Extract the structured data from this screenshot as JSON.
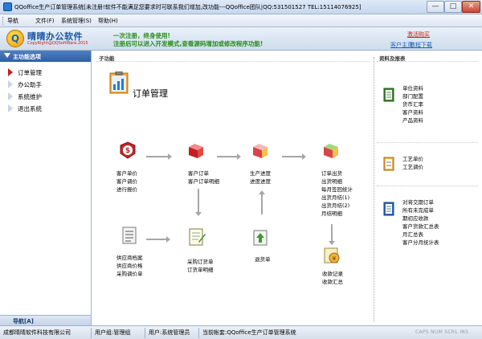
{
  "window": {
    "title": "QQoffice生产订单管理系统[未注册!软件不能满足您要求时可联系我们增加,改功能---QQoffice团队|QQ:531501527 TEL:15114076925]",
    "min_label": "—",
    "max_label": "□",
    "close_label": "✕"
  },
  "menubar": {
    "items": [
      "导航",
      "文件(F)",
      "系统管理(S)",
      "帮助(H)"
    ]
  },
  "banner": {
    "logo_letter": "Q",
    "logo_name": "晴晴办公软件",
    "logo_sub": "CopyRight@QQSoftWare.2015",
    "line1": "一次注册，终身使用!",
    "line2": "注册后可以进入开发模式,查看源码增加或修改程序功能!",
    "buy": "激活购买",
    "home": "客户主页",
    "tutorial": "教程下载"
  },
  "nav": {
    "header": "主功能选项",
    "items": [
      "订单管理",
      "办公助手",
      "系统维护",
      "退出系统"
    ],
    "active_index": 0,
    "tab": "导航[A]"
  },
  "main": {
    "section_left": "子功能",
    "section_right": "资料及报表",
    "title": "订单管理",
    "nodes": {
      "quote": [
        "客户单价",
        "客户调价",
        "进行报价"
      ],
      "order": [
        "客户订单",
        "客户订单明细"
      ],
      "progress": [
        "生产进度",
        "进度进度"
      ],
      "shipping": [
        "订单出货",
        "出货明细",
        "每月签回统计",
        "出货月结(1)",
        "出货月结(2)",
        "月结明细"
      ],
      "supplier": [
        "供应商档案",
        "供应商价格",
        "采购调价单"
      ],
      "purchase": [
        "采购订货单",
        "订货单明细"
      ],
      "return": [
        "退货单"
      ],
      "receipt": [
        "收款记录",
        "收款汇总"
      ]
    },
    "reports": {
      "group1": [
        "单位资料",
        "部门配置",
        "货币汇率",
        "客户资料",
        "产品资料"
      ],
      "group2": [
        "工艺单价",
        "工艺调价"
      ],
      "group3": [
        "对将交期订单",
        "所有未完成单",
        "期初应收款",
        "客户货款汇总表",
        "月汇总表",
        "客户分月统计表"
      ]
    }
  },
  "statusbar": {
    "company": "成都晴晴软件科技有限公司",
    "usergroup": "用户组:管理组",
    "user": "用户:系统管理员",
    "account": "当前帐套:QQoffice生产订单管理系统",
    "keys": "CAPS NUM SCRL INS"
  },
  "colors": {
    "accent": "#2d5fa2",
    "banner_text": "#2a8c1e",
    "link_red": "#c21e1e"
  }
}
